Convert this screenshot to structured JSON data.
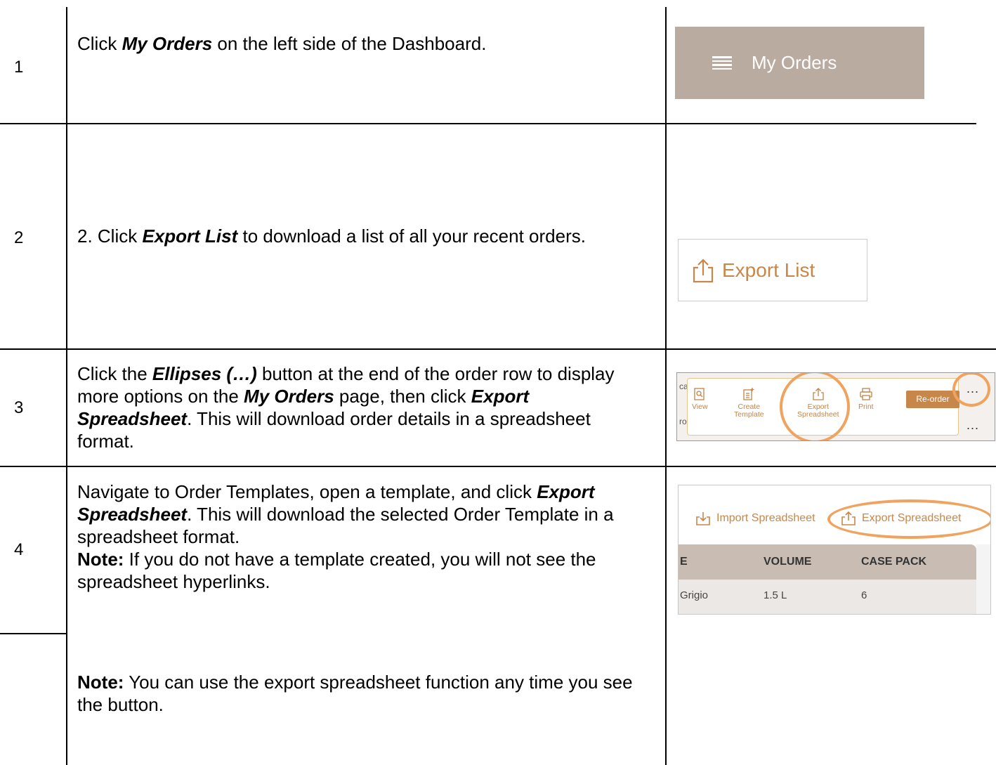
{
  "rows": [
    {
      "number": "1",
      "text_before": "Click ",
      "text_emph": "My Orders",
      "text_after": " on the left side of the Dashboard."
    },
    {
      "number": "2",
      "text_before": "2. Click ",
      "text_emph": "Export List",
      "text_after": " to download a list of all your recent orders."
    },
    {
      "number": "3",
      "text_part1": "Click the ",
      "text_emph1": "Ellipses (…)",
      "text_part2": " button at the end of the order row to display more options on the ",
      "text_emph2": "My Orders",
      "text_part3": " page, then click ",
      "text_emph3": "Export Spreadsheet",
      "text_part4": ". This will download order details in a spreadsheet format."
    },
    {
      "number": "4",
      "text_part1": "Navigate to Order Templates, open a template, and click ",
      "text_emph1": "Export Spreadsheet",
      "text_part2": ". This will download the selected Order Template in a spreadsheet format.",
      "note_label": "Note:",
      "note_text": " If you do not have a template created, you will not see the spreadsheet hyperlinks."
    }
  ],
  "footer_note": {
    "label": "Note:",
    "text": " You can use the export spreadsheet function any time you see the button."
  },
  "screenshot1": {
    "label": "My Orders",
    "bg_color": "#b9aba0",
    "icon": "menu-lines-icon"
  },
  "screenshot2": {
    "label": "Export List",
    "accent_color": "#c8874a",
    "icon": "export-upload-icon"
  },
  "screenshot3": {
    "actions": [
      {
        "label_line1": "View",
        "label_line2": "",
        "icon": "view-document-icon"
      },
      {
        "label_line1": "Create",
        "label_line2": "Template",
        "icon": "create-template-icon"
      },
      {
        "label_line1": "Export",
        "label_line2": "Spreadsheet",
        "icon": "export-upload-icon"
      },
      {
        "label_line1": "Print",
        "label_line2": "",
        "icon": "printer-icon"
      }
    ],
    "reorder_label": "Re-order",
    "ellipsis": "...",
    "fragment_top": "ca",
    "fragment_bottom": "ro",
    "highlight_color": "#f0a35e"
  },
  "screenshot4": {
    "import_label": "Import Spreadsheet",
    "export_label": "Export Spreadsheet",
    "header_fragment": "E",
    "col_volume": "VOLUME",
    "col_case_pack": "CASE PACK",
    "row_name": "Grigio",
    "row_volume": "1.5 L",
    "row_case_pack": "6"
  }
}
